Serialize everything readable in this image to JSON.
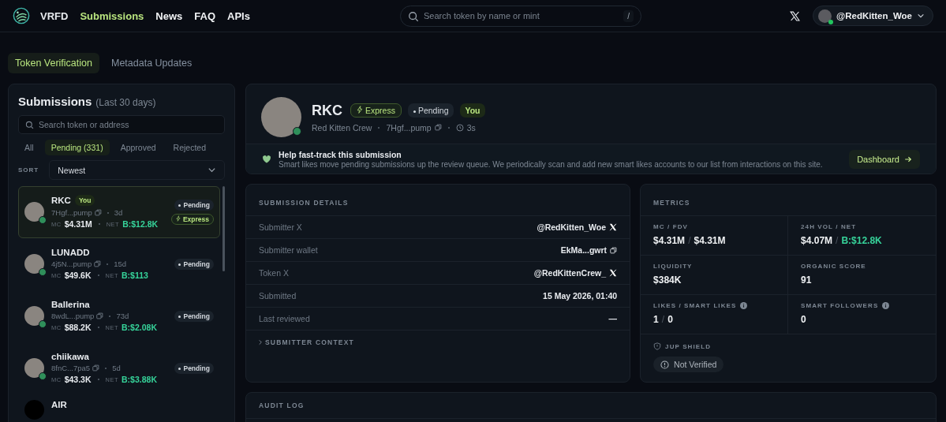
{
  "header": {
    "brand": "VRFD",
    "nav": [
      {
        "label": "Submissions",
        "selected": true
      },
      {
        "label": "News",
        "selected": false
      },
      {
        "label": "FAQ",
        "selected": false
      },
      {
        "label": "APIs",
        "selected": false
      }
    ],
    "search": {
      "placeholder": "Search token by name or mint",
      "shortcut": "/"
    },
    "user": {
      "handle": "@RedKitten_Woe",
      "online": true
    }
  },
  "page_tabs": [
    {
      "label": "Token Verification",
      "selected": true
    },
    {
      "label": "Metadata Updates",
      "selected": false
    }
  ],
  "submissions": {
    "title": "Submissions",
    "subtitle": "(Last 30 days)",
    "search": {
      "placeholder": "Search token or address"
    },
    "filters": [
      {
        "label": "All",
        "selected": false
      },
      {
        "label": "Pending (331)",
        "selected": true
      },
      {
        "label": "Approved",
        "selected": false
      },
      {
        "label": "Rejected",
        "selected": false
      }
    ],
    "sort": {
      "label": "SORT",
      "value": "Newest"
    },
    "items": [
      {
        "name": "RKC",
        "you": "You",
        "address": "7Hgf...pump",
        "age": "3d",
        "mc_label": "MC",
        "mc": "$4.31M",
        "net_label": "NET",
        "net": "B:$12.8K",
        "status": "Pending",
        "express": "Express",
        "selected": true
      },
      {
        "name": "LUNADD",
        "address": "4j5N...pump",
        "age": "15d",
        "mc_label": "MC",
        "mc": "$49.6K",
        "net_label": "NET",
        "net": "B:$113",
        "status": "Pending",
        "selected": false
      },
      {
        "name": "Ballerina",
        "address": "8wdL...pump",
        "age": "73d",
        "mc_label": "MC",
        "mc": "$88.2K",
        "net_label": "NET",
        "net": "B:$2.08K",
        "status": "Pending",
        "selected": false
      },
      {
        "name": "chiikawa",
        "address": "8fnC...7pa5",
        "age": "5d",
        "mc_label": "MC",
        "mc": "$43.3K",
        "net_label": "NET",
        "net": "B:$3.88K",
        "status": "Pending",
        "selected": false
      },
      {
        "name": "AIR",
        "selected": false
      }
    ]
  },
  "token": {
    "symbol": "RKC",
    "badges": [
      {
        "kind": "express",
        "label": "Express"
      },
      {
        "kind": "status",
        "label": "Pending"
      },
      {
        "kind": "you",
        "label": "You"
      }
    ],
    "name": "Red Kitten Crew",
    "address": "7Hgf...pump",
    "age": "3s",
    "help": {
      "title": "Help fast-track this submission",
      "text": "Smart likes move pending submissions up the review queue. We periodically scan and add new smart likes accounts to our list from interactions on this site.",
      "button": "Dashboard"
    }
  },
  "details": {
    "title": "SUBMISSION DETAILS",
    "rows": [
      {
        "label": "Submitter X",
        "value": "@RedKitten_Woe",
        "kind": "x"
      },
      {
        "label": "Submitter wallet",
        "value": "EkMa...gwrt",
        "kind": "copy"
      },
      {
        "label": "Token X",
        "value": "@RedKittenCrew_",
        "kind": "x"
      },
      {
        "label": "Submitted",
        "value": "15 May 2026, 01:40",
        "kind": "plain"
      },
      {
        "label": "Last reviewed",
        "value": "—",
        "kind": "plain"
      }
    ],
    "context": {
      "label": "SUBMITTER CONTEXT",
      "expanded": false
    }
  },
  "metrics": {
    "title": "METRICS",
    "cells": [
      {
        "label": "MC / FDV",
        "info": false,
        "parts": [
          {
            "text": "$4.31M",
            "kind": "plain"
          },
          {
            "text": "/",
            "kind": "muted"
          },
          {
            "text": "$4.31M",
            "kind": "plain"
          }
        ]
      },
      {
        "label": "24H VOL / NET",
        "info": false,
        "parts": [
          {
            "text": "$4.07M",
            "kind": "plain"
          },
          {
            "text": "/",
            "kind": "muted"
          },
          {
            "text": "B:$12.8K",
            "kind": "positive"
          }
        ]
      },
      {
        "label": "LIQUIDITY",
        "info": false,
        "parts": [
          {
            "text": "$384K",
            "kind": "plain"
          }
        ]
      },
      {
        "label": "ORGANIC SCORE",
        "info": false,
        "parts": [
          {
            "text": "91",
            "kind": "plain"
          }
        ]
      },
      {
        "label": "LIKES / SMART LIKES",
        "info": true,
        "parts": [
          {
            "text": "1",
            "kind": "plain"
          },
          {
            "text": "/",
            "kind": "muted"
          },
          {
            "text": "0",
            "kind": "plain"
          }
        ]
      },
      {
        "label": "SMART FOLLOWERS",
        "info": true,
        "parts": [
          {
            "text": "0",
            "kind": "plain"
          }
        ]
      }
    ],
    "shield": {
      "label": "JUP SHIELD",
      "status": "Not Verified"
    }
  },
  "audit": {
    "title": "AUDIT LOG"
  }
}
